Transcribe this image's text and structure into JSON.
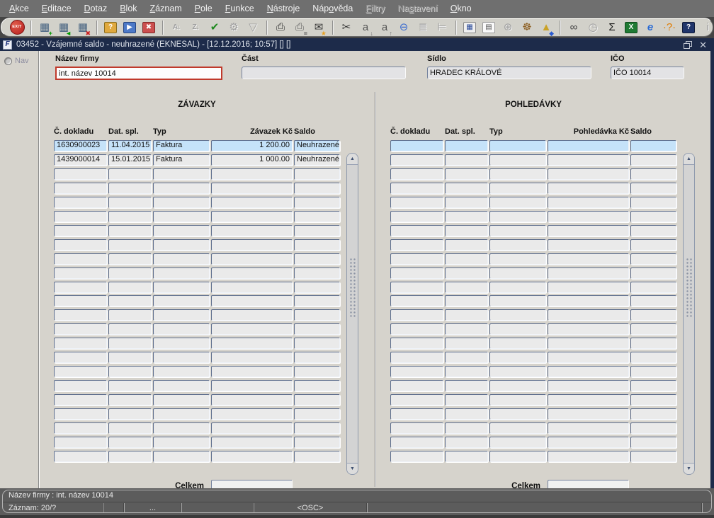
{
  "menu": {
    "items": [
      {
        "label": "Akce",
        "accel": 0,
        "enabled": true
      },
      {
        "label": "Editace",
        "accel": 0,
        "enabled": true
      },
      {
        "label": "Dotaz",
        "accel": 0,
        "enabled": true
      },
      {
        "label": "Blok",
        "accel": 0,
        "enabled": true
      },
      {
        "label": "Záznam",
        "accel": 0,
        "enabled": true
      },
      {
        "label": "Pole",
        "accel": 0,
        "enabled": true
      },
      {
        "label": "Funkce",
        "accel": 0,
        "enabled": true
      },
      {
        "label": "Nástroje",
        "accel": 0,
        "enabled": true
      },
      {
        "label": "Nápověda",
        "accel": 3,
        "enabled": true
      },
      {
        "label": "Filtry",
        "accel": 0,
        "enabled": false
      },
      {
        "label": "Nastavení",
        "accel": 2,
        "enabled": false
      },
      {
        "label": "Okno",
        "accel": 0,
        "enabled": true
      }
    ]
  },
  "toolbar": {
    "buttons": [
      {
        "name": "exit-button",
        "style": "exit",
        "glyph": "EXIT"
      },
      {
        "sep": true
      },
      {
        "name": "insert-record-button",
        "glyph": "▦",
        "color": "#44617f",
        "badge": "+",
        "badge_color": "#009900"
      },
      {
        "name": "update-record-button",
        "glyph": "▦",
        "color": "#44617f",
        "badge": "◄",
        "badge_color": "#009900"
      },
      {
        "name": "delete-record-button",
        "glyph": "▦",
        "color": "#44617f",
        "badge": "✖",
        "badge_color": "#cc2222"
      },
      {
        "sep": true
      },
      {
        "name": "enter-query-button",
        "glyph": "?",
        "box": "#e0a93f",
        "box_border": "#8a6d1f",
        "color": "#ffffff"
      },
      {
        "name": "execute-query-button",
        "glyph": "▶",
        "box": "#4d79c7",
        "box_border": "#27457f",
        "color": "#ffffff"
      },
      {
        "name": "cancel-query-button",
        "glyph": "✖",
        "box": "#cc4f4f",
        "box_border": "#7f2727",
        "color": "#ffffff"
      },
      {
        "sep": true
      },
      {
        "name": "sort-ascending-button",
        "glyph": "A↓",
        "text_icon": true,
        "enabled": false
      },
      {
        "name": "sort-descending-button",
        "glyph": "Z↓",
        "text_icon": true,
        "enabled": false
      },
      {
        "name": "commit-button",
        "glyph": "✔",
        "color": "#1f8a1f"
      },
      {
        "name": "tools-button",
        "glyph": "⚙",
        "enabled": false
      },
      {
        "name": "filter-button",
        "glyph": "▽",
        "enabled": false
      },
      {
        "sep": true
      },
      {
        "name": "print-button",
        "glyph": "⎙",
        "color": "#333333"
      },
      {
        "name": "print-setup-button",
        "glyph": "⎙",
        "color": "#666666",
        "badge": "≡",
        "badge_color": "#555555"
      },
      {
        "name": "send-mail-button",
        "glyph": "✉",
        "color": "#333333",
        "badge": "★",
        "badge_color": "#e8a020"
      },
      {
        "sep": true
      },
      {
        "name": "cut-button",
        "glyph": "✂",
        "color": "#333333"
      },
      {
        "name": "paste-down-button",
        "glyph": "a",
        "color": "#555555",
        "badge": "↓",
        "badge_color": "#777777"
      },
      {
        "name": "paste-up-button",
        "glyph": "a",
        "color": "#555555",
        "badge": "↑",
        "badge_color": "#777777"
      },
      {
        "name": "zoom-magnifier-button",
        "glyph": "⊖",
        "color": "#3a6bd0"
      },
      {
        "name": "outline-list-button",
        "glyph": "≣",
        "enabled": false
      },
      {
        "name": "outline-tree-button",
        "glyph": "⊨",
        "enabled": false
      },
      {
        "sep": true
      },
      {
        "name": "detail-form-button",
        "glyph": "▦",
        "color": "#2a4a9a",
        "box": "#f0f0f0",
        "box_border": "#888888"
      },
      {
        "name": "document-button",
        "glyph": "▤",
        "color": "#555555",
        "box": "#fafafa",
        "box_border": "#999999"
      },
      {
        "name": "globe-button",
        "glyph": "⊕",
        "enabled": false
      },
      {
        "name": "helm-button",
        "glyph": "☸",
        "color": "#8a5a1a"
      },
      {
        "name": "wizard-button",
        "glyph": "▲",
        "color": "#caa227",
        "badge": "◆",
        "badge_color": "#2a5bd0"
      },
      {
        "sep": true
      },
      {
        "name": "binoculars-button",
        "glyph": "∞",
        "color": "#444444"
      },
      {
        "name": "clock-button",
        "glyph": "◷",
        "enabled": false
      },
      {
        "name": "sum-button",
        "glyph": "Σ",
        "color": "#111111"
      },
      {
        "name": "excel-export-button",
        "glyph": "X",
        "box": "#1f7a33",
        "box_border": "#0f4a1d",
        "color": "#ffffff"
      },
      {
        "name": "web-browser-button",
        "glyph": "e",
        "color": "#2a6bd4",
        "italic": true
      },
      {
        "name": "hint-button",
        "glyph": "·?·",
        "color": "#e07b00"
      },
      {
        "name": "help-button",
        "glyph": "?",
        "box": "#20356b",
        "box_border": "#101b3a",
        "color": "#ffffff"
      },
      {
        "name": "info-button",
        "glyph": "i",
        "enabled": false
      }
    ]
  },
  "window": {
    "title": "03452 - Vzájemné saldo - neuhrazené (EKNESAL) - [12.12.2016; 10:57]  []  []",
    "icon_glyph": "F"
  },
  "nav": {
    "label": "Nav"
  },
  "fields": {
    "nazev": {
      "label": "Název firmy",
      "value": "int. název 10014"
    },
    "cast": {
      "label": "Část",
      "value": ""
    },
    "sidlo": {
      "label": "Sídlo",
      "value": "HRADEC KRÁLOVÉ"
    },
    "ico": {
      "label": "IČO",
      "value": "IČO 10014"
    }
  },
  "zavazky": {
    "title": "ZÁVAZKY",
    "columns": [
      "Č. dokladu",
      "Dat. spl.",
      "Typ",
      "Závazek Kč",
      "Saldo"
    ],
    "rows": [
      [
        "1630900023",
        "11.04.2015",
        "Faktura",
        "1 200.00",
        "Neuhrazené"
      ],
      [
        "1439000014",
        "15.01.2015",
        "Faktura",
        "1 000.00",
        "Neuhrazené"
      ]
    ],
    "visible_rows": 23,
    "celkem_label": "Celkem",
    "celkem_value": ""
  },
  "pohledavky": {
    "title": "POHLEDÁVKY",
    "columns": [
      "Č. dokladu",
      "Dat. spl.",
      "Typ",
      "Pohledávka Kč",
      "Saldo"
    ],
    "rows": [],
    "visible_rows": 23,
    "celkem_label": "Celkem",
    "celkem_value": ""
  },
  "statusbar": {
    "line1": "Název firmy : int. název 10014",
    "record": "Záznam: 20/?",
    "dots": "...",
    "osc": "<OSC>"
  },
  "icons": {
    "arrow_up": "▲",
    "arrow_down": "▼",
    "close": "✕"
  },
  "colors": {
    "titlebar": "#1d2b4a",
    "canvas": "#d6d3cc",
    "active_row": "#c5e2f9",
    "field_alert_border": "#c0392b",
    "statusbar": "#5c5c5c",
    "menubar": "#6f6f6f"
  }
}
